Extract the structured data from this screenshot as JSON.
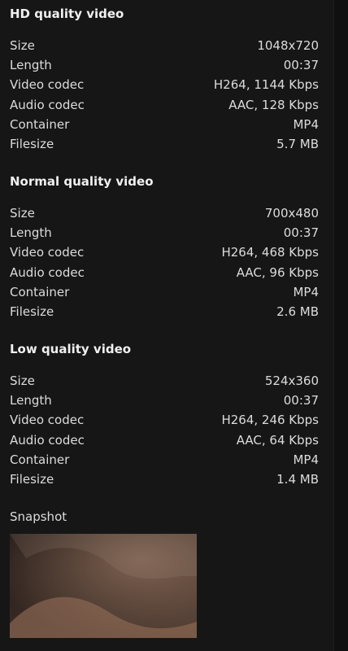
{
  "sections": [
    {
      "title": "HD quality video",
      "rows": [
        {
          "label": "Size",
          "value": "1048x720"
        },
        {
          "label": "Length",
          "value": "00:37"
        },
        {
          "label": "Video codec",
          "value": "H264, 1144 Kbps"
        },
        {
          "label": "Audio codec",
          "value": "AAC, 128 Kbps"
        },
        {
          "label": "Container",
          "value": "MP4"
        },
        {
          "label": "Filesize",
          "value": "5.7 MB"
        }
      ]
    },
    {
      "title": "Normal quality video",
      "rows": [
        {
          "label": "Size",
          "value": "700x480"
        },
        {
          "label": "Length",
          "value": "00:37"
        },
        {
          "label": "Video codec",
          "value": "H264, 468 Kbps"
        },
        {
          "label": "Audio codec",
          "value": "AAC, 96 Kbps"
        },
        {
          "label": "Container",
          "value": "MP4"
        },
        {
          "label": "Filesize",
          "value": "2.6 MB"
        }
      ]
    },
    {
      "title": "Low quality video",
      "rows": [
        {
          "label": "Size",
          "value": "524x360"
        },
        {
          "label": "Length",
          "value": "00:37"
        },
        {
          "label": "Video codec",
          "value": "H264, 246 Kbps"
        },
        {
          "label": "Audio codec",
          "value": "AAC, 64 Kbps"
        },
        {
          "label": "Container",
          "value": "MP4"
        },
        {
          "label": "Filesize",
          "value": "1.4 MB"
        }
      ]
    }
  ],
  "snapshot": {
    "label": "Snapshot"
  }
}
